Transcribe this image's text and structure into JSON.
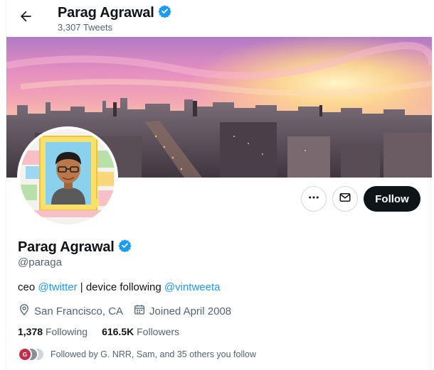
{
  "header": {
    "name": "Parag Agrawal",
    "tweet_count": "3,307 Tweets"
  },
  "profile": {
    "display_name": "Parag Agrawal",
    "handle": "@paraga",
    "bio_prefix": "ceo ",
    "bio_link1": "@twitter",
    "bio_middle": " | device following ",
    "bio_link2": "@vintweeta",
    "location": "San Francisco, CA",
    "joined": "Joined April 2008",
    "following_count": "1,378",
    "following_label": "Following",
    "followers_count": "616.5K",
    "followers_label": "Followers",
    "followed_by": "Followed by G. NRR, Sam, and 35 others you follow",
    "mini_avatar_initial": "G"
  },
  "actions": {
    "follow_label": "Follow"
  },
  "icons": {
    "back": "arrow-left-icon",
    "verified": "verified-badge-icon",
    "more": "more-icon",
    "message": "mail-icon",
    "location": "location-pin-icon",
    "calendar": "calendar-icon"
  },
  "colors": {
    "accent": "#1d9bf0",
    "follow_button": "#0f1419",
    "secondary_text": "#536471"
  }
}
